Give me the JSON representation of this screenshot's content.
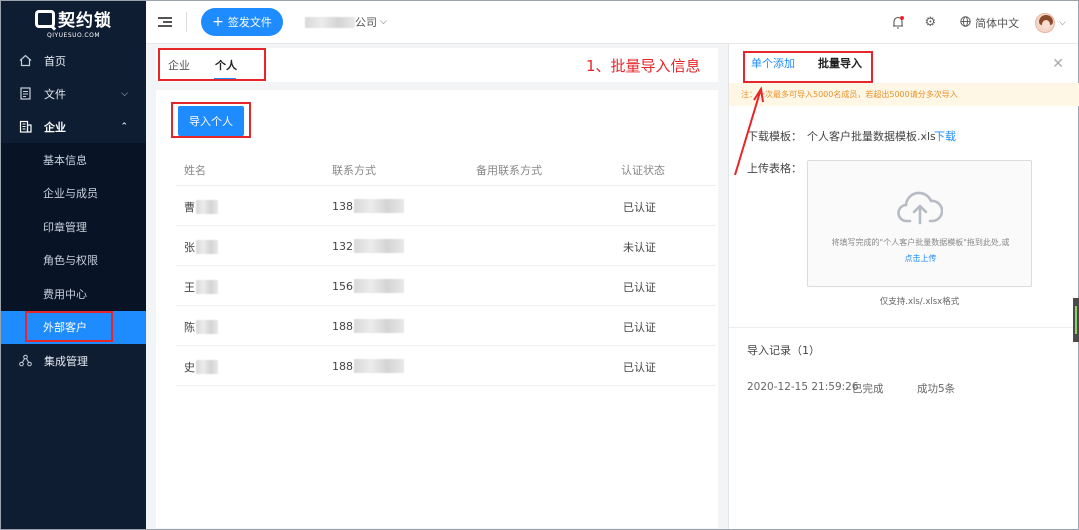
{
  "sidebar": {
    "logo_text": "契约锁",
    "logo_sub": "QIYUESUO.COM",
    "items": [
      {
        "label": "首页",
        "icon": "home-icon"
      },
      {
        "label": "文件",
        "icon": "file-icon"
      },
      {
        "label": "企业",
        "icon": "building-icon"
      }
    ],
    "sub_items": [
      {
        "label": "基本信息"
      },
      {
        "label": "企业与成员"
      },
      {
        "label": "印章管理"
      },
      {
        "label": "角色与权限"
      },
      {
        "label": "费用中心"
      },
      {
        "label": "外部客户"
      }
    ],
    "integration": {
      "label": "集成管理",
      "icon": "integration-icon"
    }
  },
  "header": {
    "sign_button": "签发文件",
    "company_suffix": "公司",
    "language": "简体中文"
  },
  "main": {
    "tabs": [
      {
        "label": "企业"
      },
      {
        "label": "个人"
      }
    ],
    "annotation": "1、批量导入信息",
    "import_button": "导入个人",
    "columns": [
      "姓名",
      "联系方式",
      "备用联系方式",
      "认证状态"
    ],
    "rows": [
      {
        "name": "曹",
        "phone": "138",
        "status": "已认证"
      },
      {
        "name": "张",
        "phone": "132",
        "status": "未认证"
      },
      {
        "name": "王",
        "phone": "156",
        "status": "已认证"
      },
      {
        "name": "陈",
        "phone": "188",
        "status": "已认证"
      },
      {
        "name": "史",
        "phone": "188",
        "status": "已认证"
      }
    ]
  },
  "drawer": {
    "tab_single": "单个添加",
    "tab_batch": "批量导入",
    "notice": "注：一次最多可导入5000名成员，若超出5000请分多次导入",
    "template_label": "下载模板：",
    "template_name": "个人客户批量数据模板.xls",
    "download_link": "下载",
    "upload_label": "上传表格：",
    "upload_hint": "将填写完成的\"个人客户批量数据模板\"拖到此处,或",
    "upload_link": "点击上传",
    "upload_formats": "仅支持.xls/.xlsx格式",
    "records_title": "导入记录（1）",
    "record": {
      "time": "2020-12-15 21:59:26",
      "status": "已完成",
      "result": "成功5条"
    }
  },
  "colors": {
    "accent": "#1e8cff",
    "sidebar_bg": "#0f1d33",
    "annotation": "#e6262b"
  }
}
